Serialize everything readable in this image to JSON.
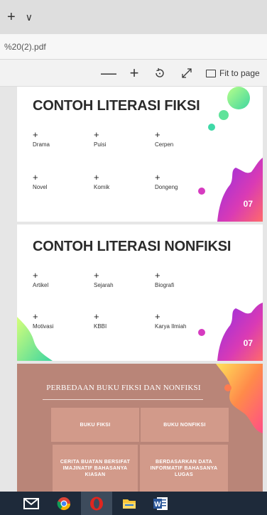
{
  "window": {
    "plus_label": "+",
    "chevron_label": "∨"
  },
  "address": {
    "text": "%20(2).pdf"
  },
  "toolbar": {
    "zoom_out_label": "—",
    "zoom_in_label": "+",
    "fit_label": "Fit to page"
  },
  "pages": {
    "fiksi": {
      "title": "CONTOH LITERASI FIKSI",
      "items": [
        "Drama",
        "Puisi",
        "Cerpen",
        "Novel",
        "Komik",
        "Dongeng"
      ],
      "plus": "+",
      "page_number": "07"
    },
    "nonfiksi": {
      "title": "CONTOH LITERASI NONFIKSI",
      "items": [
        "Artikel",
        "Sejarah",
        "Biografi",
        "Motivasi",
        "KBBI",
        "Karya Ilmiah"
      ],
      "plus": "+",
      "page_number": "07"
    },
    "perbedaan": {
      "title": "PERBEDAAN BUKU FIKSI DAN NONFIKSI",
      "head_fiksi": "BUKU FIKSI",
      "head_nonfiksi": "BUKU NONFIKSI",
      "desc_fiksi": "CERITA BUATAN BERSIFAT IMAJINATIF BAHASANYA KIASAN",
      "desc_nonfiksi": "BERDASARKAN DATA INFORMATIF BAHASANYA LUGAS"
    }
  },
  "taskbar": {
    "word_letter": "W"
  },
  "colors": {
    "page3_bg": "#b98578",
    "cell_bg": "#d29a8a",
    "blob_purple": "#b533d6",
    "blob_pink": "#ff4f86",
    "blob_green": "#55e39a",
    "taskbar_bg": "#1e2a3a"
  }
}
